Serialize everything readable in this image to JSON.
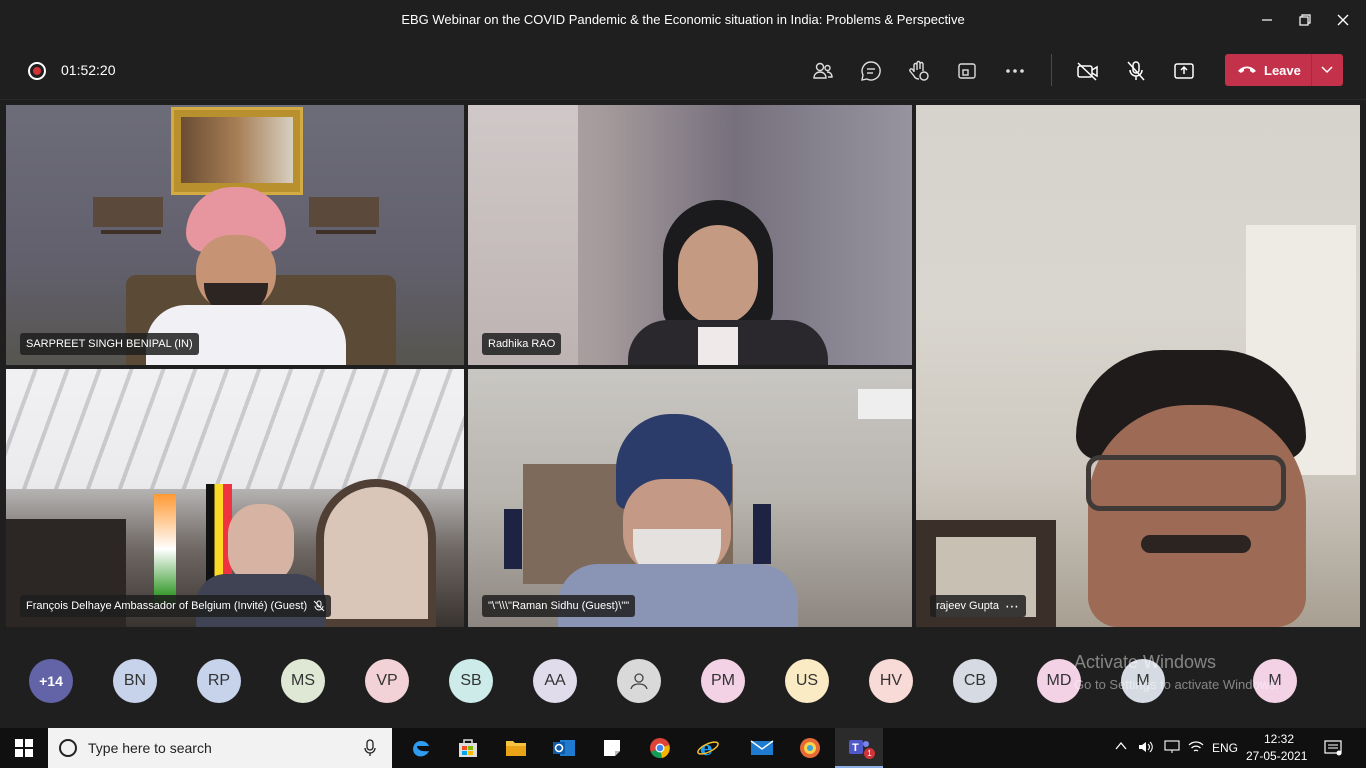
{
  "window": {
    "title": "EBG Webinar on the COVID Pandemic & the Economic situation in India: Problems & Perspective"
  },
  "toolbar": {
    "timer": "01:52:20",
    "leave_label": "Leave",
    "colors": {
      "leave": "#c4314b",
      "record": "#d13438"
    }
  },
  "tiles": [
    {
      "name": "SARPREET SINGH BENIPAL (IN)"
    },
    {
      "name": "Radhika RAO"
    },
    {
      "name": "rajeev Gupta"
    },
    {
      "name": "François Delhaye Ambassador of Belgium (Invité) (Guest)"
    },
    {
      "name": "\"\\\"\\\\\\\"Raman Sidhu (Guest)\\\"\""
    }
  ],
  "participants": {
    "overflow": "+14",
    "avatars": [
      "BN",
      "RP",
      "MS",
      "VP",
      "SB",
      "AA",
      "",
      "PM",
      "US",
      "HV",
      "CB",
      "MD",
      "M",
      "M"
    ]
  },
  "watermark": {
    "line1": "Activate Windows",
    "line2": "Go to Settings to activate Windows."
  },
  "taskbar": {
    "search_placeholder": "Type here to search",
    "language": "ENG",
    "time": "12:32",
    "date": "27-05-2021",
    "teams_badge": "1"
  }
}
